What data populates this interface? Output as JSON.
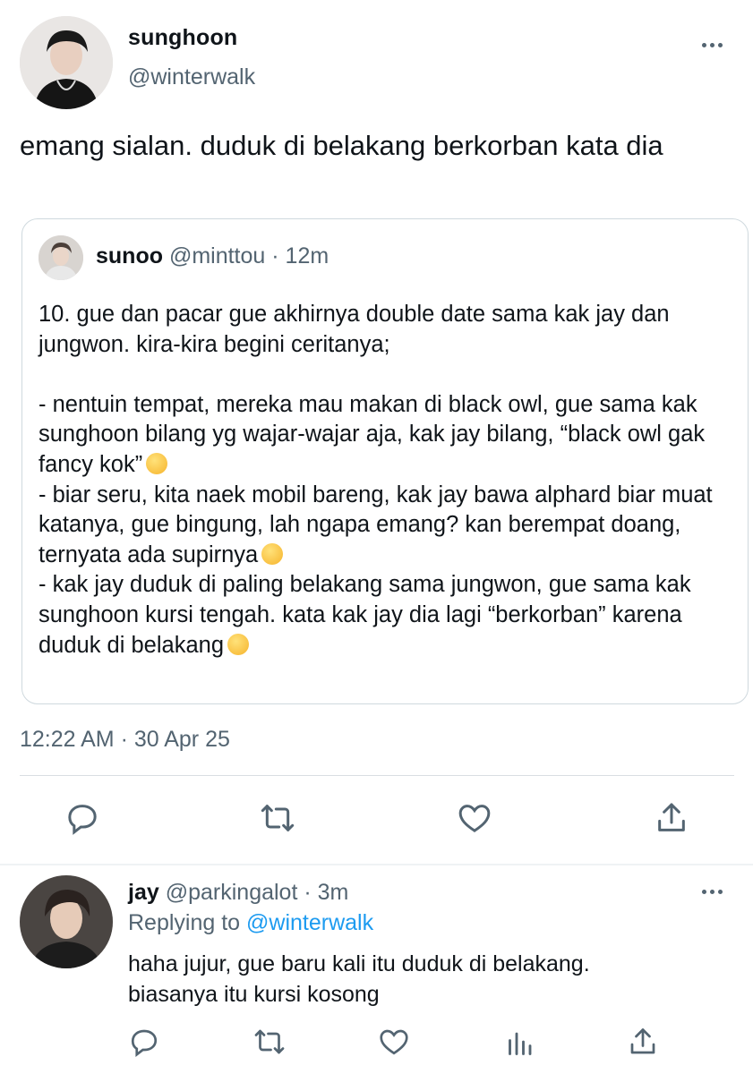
{
  "tweet": {
    "author_name": "sunghoon",
    "author_handle": "@winterwalk",
    "text": "emang sialan. duduk di belakang berkorban kata dia",
    "timestamp": "12:22 AM · 30 Apr 25",
    "more_icon": "more-horizontal-icon"
  },
  "quote": {
    "author_name": "sunoo",
    "author_handle": "@minttou",
    "separator": " · ",
    "time_ago": "12m",
    "lines": [
      "10. gue dan pacar gue akhirnya double date sama kak jay dan jungwon. kira-kira begini ceritanya;",
      "",
      "- nentuin tempat, mereka mau makan di black owl, gue sama kak sunghoon bilang yg wajar-wajar aja, kak jay bilang, “black owl gak fancy kok”",
      "- biar seru, kita naek mobil bareng, kak jay bawa alphard biar muat katanya, gue bingung, lah ngapa emang? kan berempat doang, ternyata ada supirnya",
      "- kak jay duduk di paling belakang sama jungwon, gue sama kak sunghoon kursi tengah. kata kak jay dia lagi “berkorban” karena duduk di belakang"
    ],
    "emojis": [
      "grinning-sweat-emoji",
      "downcast-sweat-emoji",
      "persevering-face-emoji"
    ]
  },
  "actions": [
    "reply-icon",
    "retweet-icon",
    "like-icon",
    "share-icon"
  ],
  "reply": {
    "author_name": "jay",
    "author_handle": "@parkingalot",
    "separator": " · ",
    "time_ago": "3m",
    "replying_prefix": "Replying to ",
    "replying_to": "@winterwalk",
    "text_line1": "haha jujur, gue baru kali itu duduk di belakang.",
    "text_line2": "biasanya itu kursi kosong",
    "actions": [
      "reply-icon",
      "retweet-icon",
      "like-icon",
      "analytics-icon",
      "share-icon"
    ]
  },
  "colors": {
    "text": "#0f1419",
    "muted": "#536471",
    "link": "#1d9bf0",
    "border": "#cfd9de"
  }
}
